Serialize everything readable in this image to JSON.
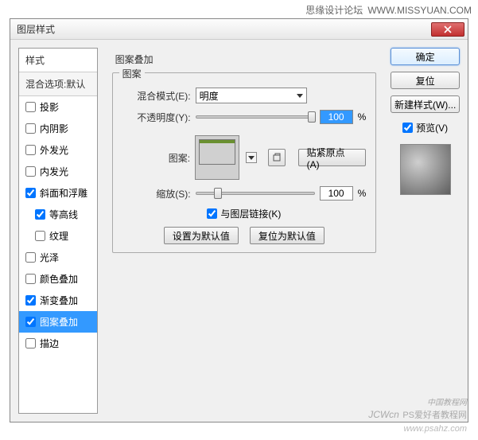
{
  "header": {
    "site": "思缘设计论坛",
    "url": "WWW.MISSYUAN.COM"
  },
  "dialog": {
    "title": "图层样式"
  },
  "styles": {
    "header": "样式",
    "blendOptions": "混合选项:默认",
    "items": [
      {
        "label": "投影",
        "checked": false,
        "indent": false
      },
      {
        "label": "内阴影",
        "checked": false,
        "indent": false
      },
      {
        "label": "外发光",
        "checked": false,
        "indent": false
      },
      {
        "label": "内发光",
        "checked": false,
        "indent": false
      },
      {
        "label": "斜面和浮雕",
        "checked": true,
        "indent": false
      },
      {
        "label": "等高线",
        "checked": true,
        "indent": true
      },
      {
        "label": "纹理",
        "checked": false,
        "indent": true
      },
      {
        "label": "光泽",
        "checked": false,
        "indent": false
      },
      {
        "label": "颜色叠加",
        "checked": false,
        "indent": false
      },
      {
        "label": "渐变叠加",
        "checked": true,
        "indent": false
      },
      {
        "label": "图案叠加",
        "checked": true,
        "indent": false,
        "selected": true
      },
      {
        "label": "描边",
        "checked": false,
        "indent": false
      }
    ]
  },
  "main": {
    "sectionTitle": "图案叠加",
    "patternGroup": "图案",
    "blendModeLabel": "混合模式(E):",
    "blendModeValue": "明度",
    "opacityLabel": "不透明度(Y):",
    "opacityValue": "100",
    "percent": "%",
    "patternLabel": "图案:",
    "snapButton": "贴紧原点(A)",
    "scaleLabel": "缩放(S):",
    "scaleValue": "100",
    "linkLayerLabel": "与图层链接(K)",
    "setDefault": "设置为默认值",
    "resetDefault": "复位为默认值"
  },
  "right": {
    "ok": "确定",
    "cancel": "复位",
    "newStyle": "新建样式(W)...",
    "previewLabel": "预览(V)"
  },
  "watermark": {
    "brand": "JCWcn",
    "sub": "PS爱好者教程网",
    "url": "www.psahz.com",
    "extra": "中国教程网"
  }
}
